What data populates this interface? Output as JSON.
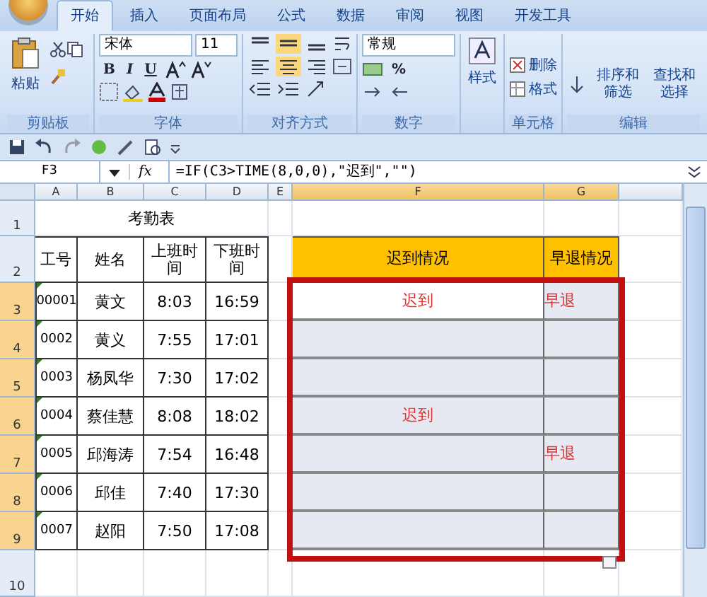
{
  "tabs": [
    {
      "label": "开始",
      "selected": true
    },
    {
      "label": "插入",
      "selected": false
    },
    {
      "label": "页面布局",
      "selected": false
    },
    {
      "label": "公式",
      "selected": false
    },
    {
      "label": "数据",
      "selected": false
    },
    {
      "label": "审阅",
      "selected": false
    },
    {
      "label": "视图",
      "selected": false
    },
    {
      "label": "开发工具",
      "selected": false
    }
  ],
  "ribbon": {
    "clipboard": {
      "label": "剪贴板",
      "paste": "粘贴"
    },
    "font": {
      "label": "字体",
      "family": "宋体",
      "size": "11",
      "styles": [
        "B",
        "I",
        "U"
      ]
    },
    "alignment": {
      "label": "对齐方式"
    },
    "number": {
      "label": "数字",
      "format": "常规",
      "percent": "%"
    },
    "styles": {
      "button": "样式"
    },
    "cells": {
      "label": "单元格",
      "delete": "删除",
      "format": "格式"
    },
    "editing": {
      "label": "编辑",
      "sort": "排序和筛选",
      "find": "查找和选择"
    }
  },
  "formula_bar": {
    "name_box": "F3",
    "function_symbol": "fx",
    "formula": "=IF(C3>TIME(8,0,0),\"迟到\",\"\")"
  },
  "sheet": {
    "columns": [
      {
        "label": "A",
        "selected": false
      },
      {
        "label": "B",
        "selected": false
      },
      {
        "label": "C",
        "selected": false
      },
      {
        "label": "D",
        "selected": false
      },
      {
        "label": "E",
        "selected": false
      },
      {
        "label": "F",
        "selected": true
      },
      {
        "label": "G",
        "selected": true
      }
    ],
    "row_numbers": [
      {
        "label": "1",
        "selected": false
      },
      {
        "label": "2",
        "selected": false
      },
      {
        "label": "3",
        "selected": true
      },
      {
        "label": "4",
        "selected": true
      },
      {
        "label": "5",
        "selected": true
      },
      {
        "label": "6",
        "selected": true
      },
      {
        "label": "7",
        "selected": true
      },
      {
        "label": "8",
        "selected": true
      },
      {
        "label": "9",
        "selected": true
      },
      {
        "label": "10",
        "selected": false
      }
    ],
    "title": "考勤表",
    "headers": [
      "工号",
      "姓名",
      "上班时间",
      "下班时间"
    ],
    "status_headers": [
      "迟到情况",
      "早退情况"
    ],
    "records": [
      {
        "id": "00001",
        "name": "黄文",
        "in": "8:03",
        "out": "16:59",
        "late": "迟到",
        "early": "早退",
        "flagged": true,
        "active": true
      },
      {
        "id": "0002",
        "name": "黄义",
        "in": "7:55",
        "out": "17:01",
        "flagged": true,
        "active": false
      },
      {
        "id": "0003",
        "name": "杨凤华",
        "in": "7:30",
        "out": "17:02",
        "flagged": true,
        "active": false
      },
      {
        "id": "0004",
        "name": "蔡佳慧",
        "in": "8:08",
        "out": "18:02",
        "late": "迟到",
        "flagged": true,
        "active": false
      },
      {
        "id": "0005",
        "name": "邱海涛",
        "in": "7:54",
        "out": "16:48",
        "early": "早退",
        "flagged": true,
        "active": false
      },
      {
        "id": "0006",
        "name": "邱佳",
        "in": "7:40",
        "out": "17:30",
        "flagged": true,
        "active": false
      },
      {
        "id": "0007",
        "name": "赵阳",
        "in": "7:50",
        "out": "17:08",
        "flagged": true,
        "active": false
      }
    ]
  }
}
